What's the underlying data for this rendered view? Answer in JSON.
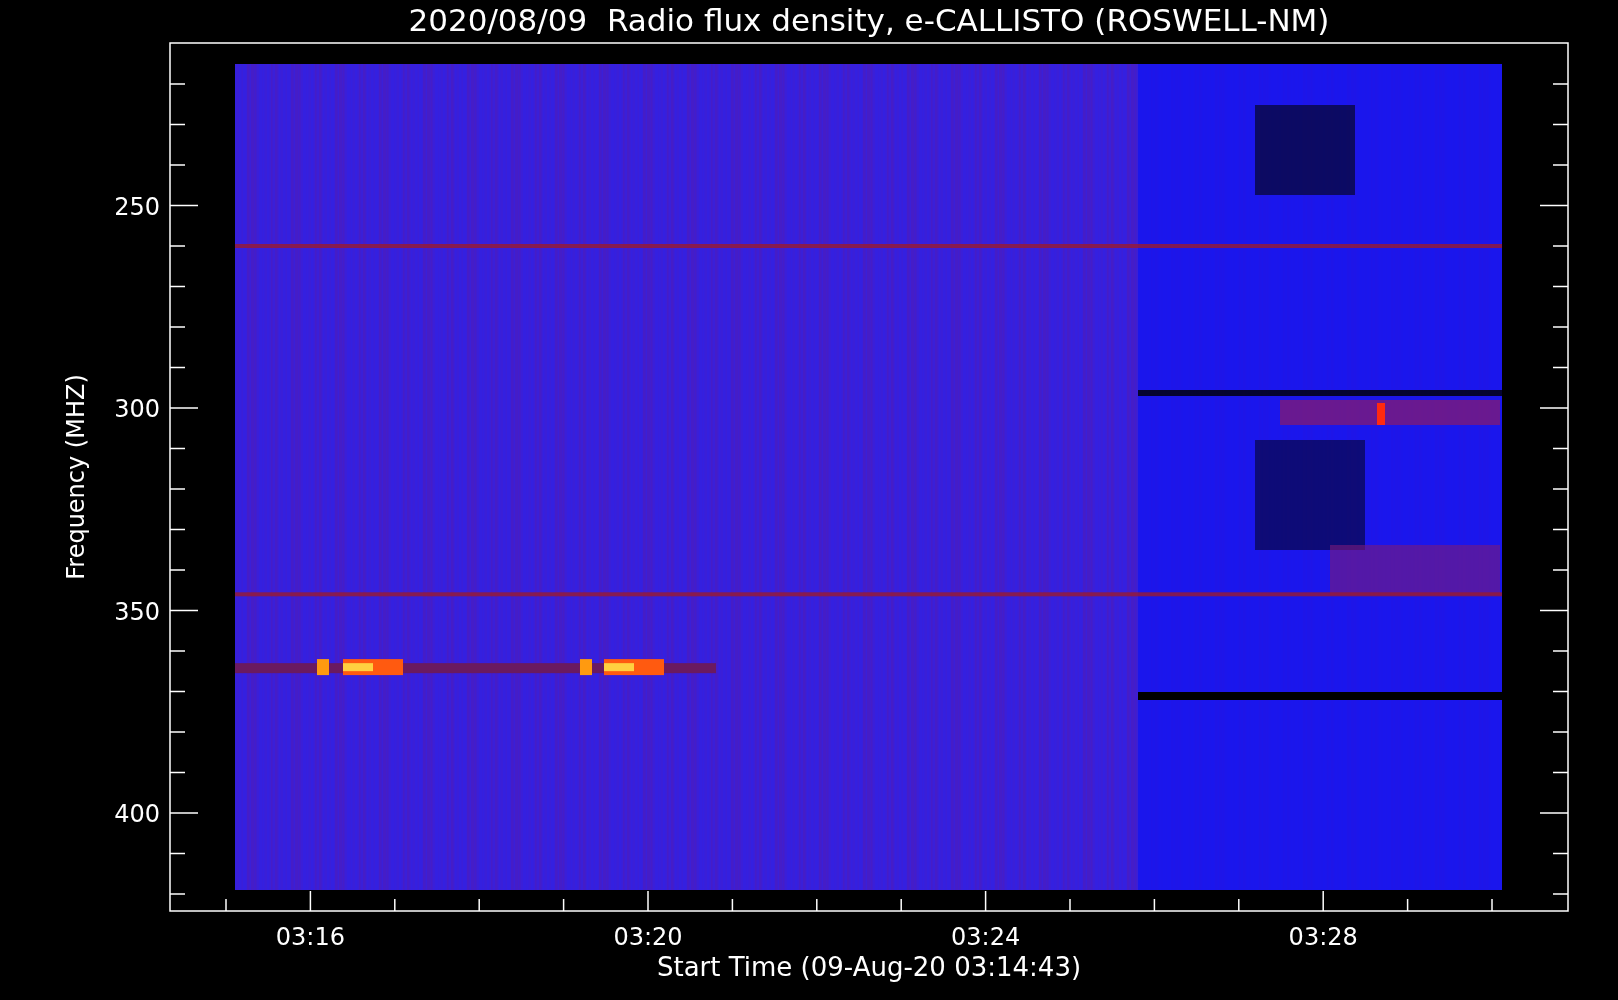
{
  "figure": {
    "title": "2020/08/09  Radio flux density, e-CALLISTO (ROSWELL-NM)",
    "xlabel": "Start Time (09-Aug-20 03:14:43)",
    "ylabel": "Frequency (MHZ)",
    "y_tick_labels": [
      "250",
      "300",
      "350",
      "400"
    ],
    "x_tick_labels": [
      "03:16",
      "03:20",
      "03:24",
      "03:28"
    ]
  }
}
